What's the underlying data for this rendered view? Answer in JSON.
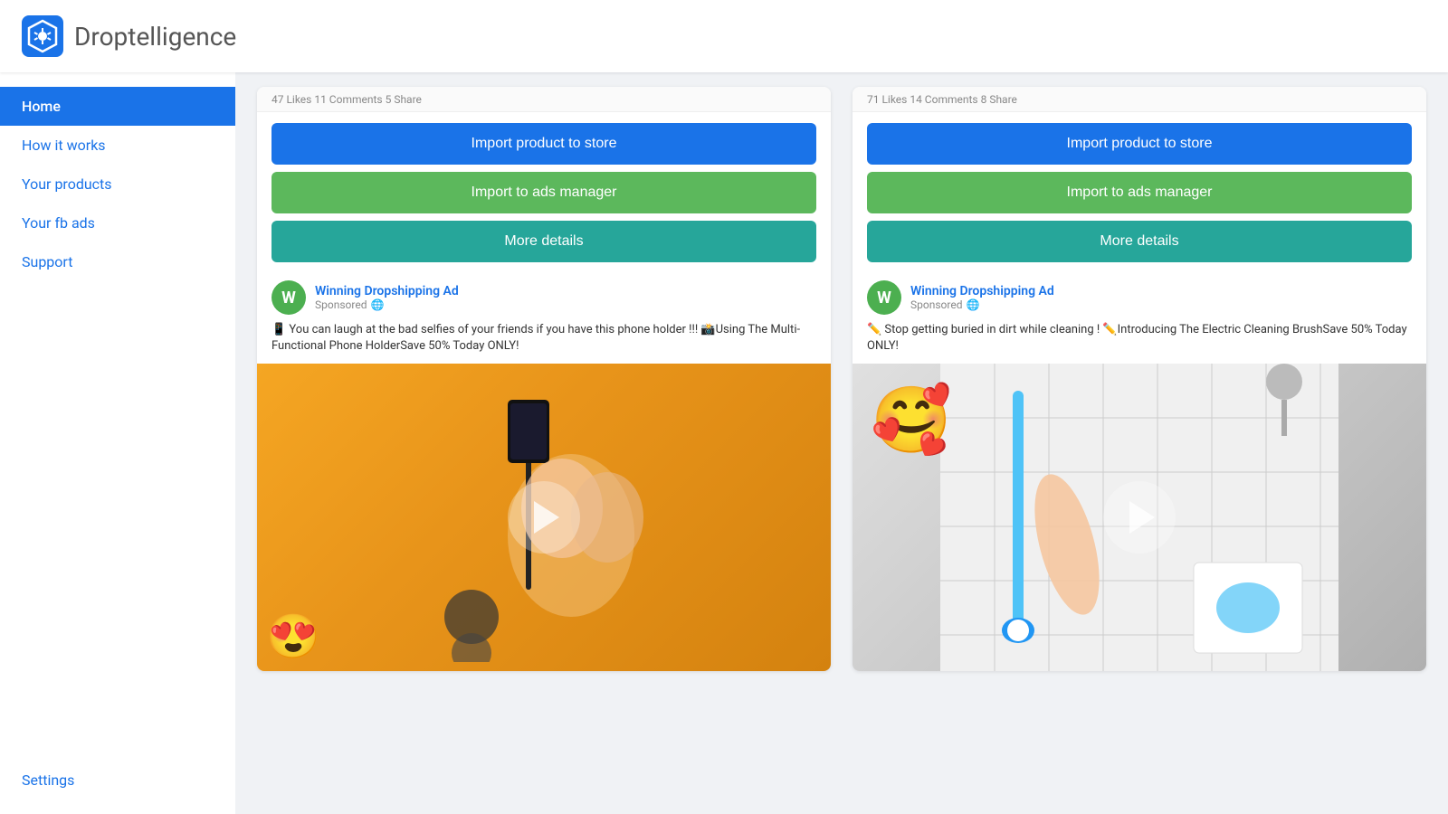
{
  "header": {
    "app_name": "Droptelligence"
  },
  "sidebar": {
    "items": [
      {
        "id": "home",
        "label": "Home",
        "active": true
      },
      {
        "id": "how-it-works",
        "label": "How it works",
        "active": false
      },
      {
        "id": "your-products",
        "label": "Your products",
        "active": false
      },
      {
        "id": "your-fb-ads",
        "label": "Your fb ads",
        "active": false
      },
      {
        "id": "support",
        "label": "Support",
        "active": false
      },
      {
        "id": "settings",
        "label": "Settings",
        "active": false
      }
    ]
  },
  "cards": [
    {
      "id": "card-1",
      "stats_bar": "47 Likes  11 Comments  5 Share",
      "btn_import_store": "Import product to store",
      "btn_import_ads": "Import to ads manager",
      "btn_more_details": "More details",
      "ad_name": "Winning Dropshipping Ad",
      "ad_sponsored": "Sponsored",
      "ad_text": "📱 You can laugh at the bad selfies of your friends if you have this phone holder !!! 📸Using The Multi-Functional Phone HolderSave 50% Today ONLY!",
      "image_type": "phone",
      "image_emoji": "😍"
    },
    {
      "id": "card-2",
      "stats_bar": "71 Likes  14 Comments  8 Share",
      "btn_import_store": "Import product to store",
      "btn_import_ads": "Import to ads manager",
      "btn_more_details": "More details",
      "ad_name": "Winning Dropshipping Ad",
      "ad_sponsored": "Sponsored",
      "ad_text": "✏️ Stop getting buried in dirt while cleaning ! ✏️Introducing The Electric Cleaning BrushSave 50% Today ONLY!",
      "image_type": "brush",
      "image_emoji": "🥰"
    }
  ],
  "icons": {
    "play": "▶",
    "globe": "🌐",
    "w_letter": "W"
  }
}
